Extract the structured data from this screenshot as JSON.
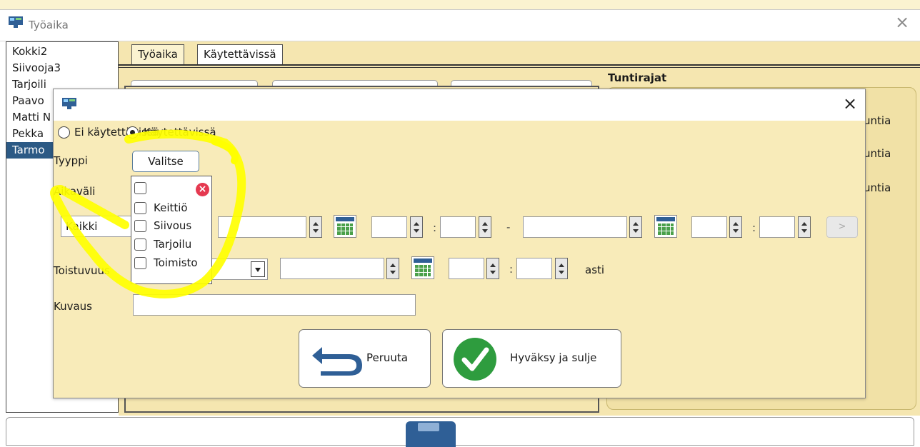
{
  "main_window": {
    "title": "Työaika",
    "close_label": "×",
    "employees": [
      "Kokki2",
      "Siivooja3",
      "Tarjoili",
      "Paavo",
      "Matti N",
      "Pekka",
      "Tarmo"
    ],
    "selected_employee_index": 6,
    "tabs": [
      {
        "label": "Työaika",
        "active": false
      },
      {
        "label": "Käytettävissä",
        "active": true
      }
    ],
    "tuntirajat": {
      "title": "Tuntirajat",
      "rows": [
        "untia",
        "untia",
        "untia"
      ]
    }
  },
  "dialog": {
    "close_label": "×",
    "availability": {
      "options": [
        "Ei käytettävissä",
        "Käytettävissä"
      ],
      "selected": "Käytettävissä"
    },
    "tyyppi": {
      "label": "Tyyppi",
      "button_label": "Valitse",
      "clear_label": "×",
      "options": [
        {
          "label": "",
          "checked": false
        },
        {
          "label": "Keittiö",
          "checked": false
        },
        {
          "label": "Siivous",
          "checked": false
        },
        {
          "label": "Tarjoilu",
          "checked": false
        },
        {
          "label": "Toimisto",
          "checked": false
        }
      ]
    },
    "aikavali": {
      "label": "Aikaväli",
      "range_value": "Kaikki",
      "start_date": "",
      "start_hour": "",
      "start_minute": "",
      "dash": "-",
      "end_date": "",
      "end_hour": "",
      "end_minute": "",
      "time_separator": ":",
      "next_label": ">"
    },
    "toistuvuus": {
      "label": "Toistuvuus",
      "value": "",
      "until_date": "",
      "until_hour": "",
      "until_minute": "",
      "until_label": "asti"
    },
    "kuvaus": {
      "label": "Kuvaus",
      "value": ""
    },
    "buttons": {
      "cancel_label": "Peruuta",
      "accept_label": "Hyväksy ja sulje"
    }
  },
  "colors": {
    "panel_bg": "#f5e6b0",
    "dialog_bg": "#f8ebb9",
    "selection": "#2c5a85",
    "highlight": "#ffff00",
    "accept_green": "#2e9c3e",
    "cancel_blue": "#2f5f96",
    "clear_red": "#e53950"
  }
}
